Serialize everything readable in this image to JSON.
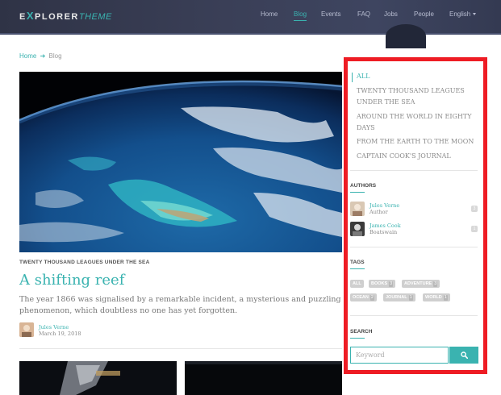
{
  "header": {
    "logo_e": "E",
    "logo_x": "X",
    "logo_plorer": "PLORER",
    "logo_theme": "THEME",
    "nav": [
      {
        "label": "Home",
        "active": false
      },
      {
        "label": "Blog",
        "active": true
      },
      {
        "label": "Events",
        "active": false
      },
      {
        "label": "FAQ",
        "active": false
      },
      {
        "label": "Jobs",
        "active": false
      },
      {
        "label": "People",
        "active": false
      },
      {
        "label": "English",
        "active": false
      }
    ]
  },
  "breadcrumb": {
    "home": "Home",
    "current": "Blog"
  },
  "post": {
    "category": "TWENTY THOUSAND LEAGUES UNDER THE SEA",
    "title": "A shifting reef",
    "excerpt": "The year 1866 was signalised by a remarkable incident, a mysterious and puzzling phenomenon, which doubtless no one has yet forgotten.",
    "author": "Jules Verne",
    "date": "March 19, 2018"
  },
  "sidebar": {
    "categories": [
      {
        "label": "ALL",
        "active": true
      },
      {
        "label": "TWENTY THOUSAND LEAGUES UNDER THE SEA",
        "active": false
      },
      {
        "label": "AROUND THE WORLD IN EIGHTY DAYS",
        "active": false
      },
      {
        "label": "FROM THE EARTH TO THE MOON",
        "active": false
      },
      {
        "label": "CAPTAIN COOK'S JOURNAL",
        "active": false
      }
    ],
    "authors_heading": "AUTHORS",
    "authors": [
      {
        "name": "Jules Verne",
        "role": "Author",
        "count": "3"
      },
      {
        "name": "James Cook",
        "role": "Boatswain",
        "count": "1"
      }
    ],
    "tags_heading": "TAGS",
    "tags": [
      {
        "label": "ALL",
        "count": ""
      },
      {
        "label": "BOOKS",
        "count": "3"
      },
      {
        "label": "ADVENTURE",
        "count": "3"
      },
      {
        "label": "OCEAN",
        "count": "2"
      },
      {
        "label": "JOURNAL",
        "count": "1"
      },
      {
        "label": "WORLD",
        "count": "1"
      }
    ],
    "search_heading": "SEARCH",
    "search_placeholder": "Keyword"
  },
  "colors": {
    "accent": "#3ab3b0",
    "highlight_frame": "#ee1c24",
    "header_bg": "#3a3f57"
  },
  "icons": {
    "search": "search-icon",
    "breadcrumb_arrow": "arrow-right-icon",
    "language_caret": "caret-down-icon"
  }
}
